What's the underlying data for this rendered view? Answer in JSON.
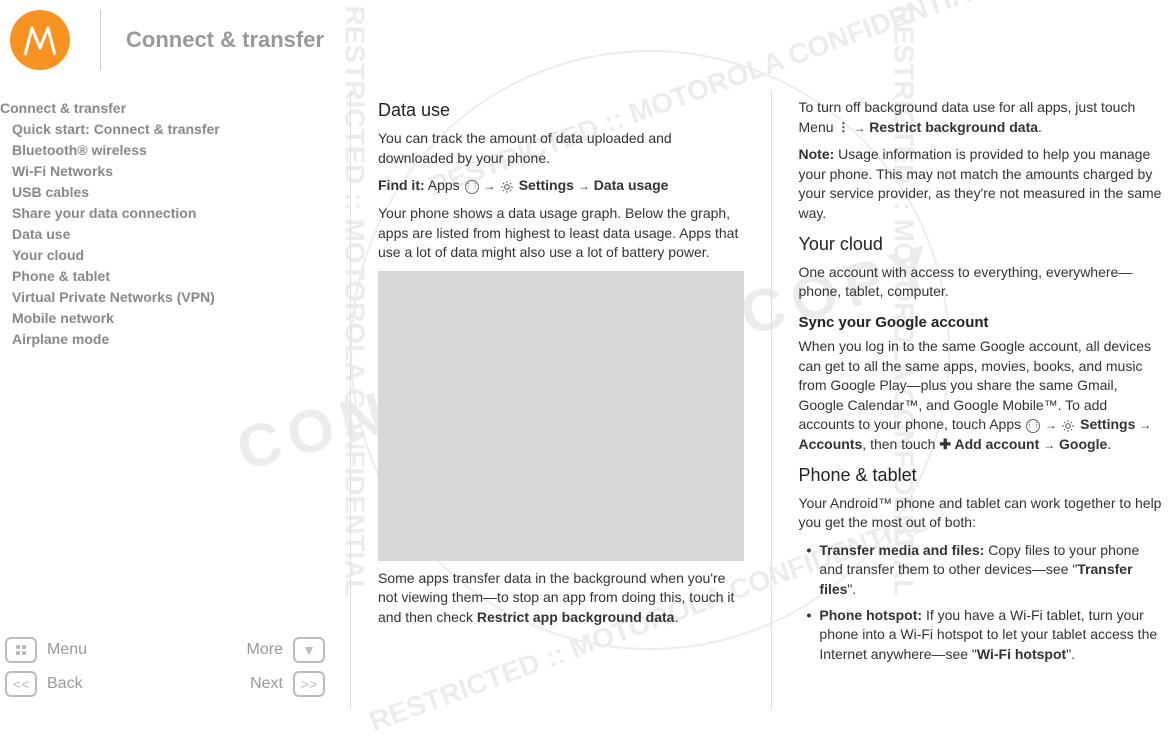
{
  "header": {
    "title": "Connect & transfer"
  },
  "sidebar": {
    "items": [
      {
        "label": "Connect & transfer",
        "level": 0
      },
      {
        "label": "Quick start: Connect & transfer",
        "level": 1
      },
      {
        "label": "Bluetooth® wireless",
        "level": 1
      },
      {
        "label": "Wi-Fi Networks",
        "level": 1
      },
      {
        "label": "USB cables",
        "level": 1
      },
      {
        "label": "Share your data connection",
        "level": 1
      },
      {
        "label": "Data use",
        "level": 1
      },
      {
        "label": "Your cloud",
        "level": 1
      },
      {
        "label": "Phone & tablet",
        "level": 1
      },
      {
        "label": "Virtual Private Networks (VPN)",
        "level": 1
      },
      {
        "label": "Mobile network",
        "level": 1
      },
      {
        "label": "Airplane mode",
        "level": 1
      }
    ]
  },
  "nav": {
    "menu": "Menu",
    "more": "More",
    "back": "Back",
    "next": "Next"
  },
  "col1": {
    "h_datause": "Data use",
    "p1": "You can track the amount of data uploaded and downloaded by your phone.",
    "findit_label": "Find it:",
    "findit_apps": " Apps ",
    "findit_settings": " Settings ",
    "findit_datausage": " Data usage",
    "p2": "Your phone shows a data usage graph. Below the graph, apps are listed from highest to least data usage. Apps that use a lot of data might also use a lot of battery power.",
    "p3a": "Some apps transfer data in the background when you're not viewing them—to stop an app from doing this, touch it and then check ",
    "p3b": "Restrict app background data",
    "p3c": "."
  },
  "col2": {
    "p1a": "To turn off background data use for all apps, just touch Menu ",
    "p1b": " Restrict background data",
    "p1c": ".",
    "note_label": "Note:",
    "note_text": " Usage information is provided to help you manage your phone. This may not match the amounts charged by your service provider, as they're not measured in the same way.",
    "h_cloud": "Your cloud",
    "p_cloud": "One account with access to everything, everywhere—phone, tablet, computer.",
    "h_sync": "Sync your Google account",
    "p_sync_a": "When you log in to the same Google account, all devices can get to all the same apps, movies, books, and music from Google Play—plus you share the same Gmail, Google Calendar™, and Google Mobile™. To add accounts to your phone, touch Apps ",
    "p_sync_settings": " Settings ",
    "p_sync_accounts": " Accounts",
    "p_sync_then": ", then touch ",
    "p_sync_add": " Add account ",
    "p_sync_google": " Google",
    "p_sync_end": ".",
    "h_pt": "Phone & tablet",
    "p_pt": "Your Android™ phone and tablet can work together to help you get the most out of both:",
    "b1_label": "Transfer media and files:",
    "b1_text_a": " Copy files to your phone and transfer them to other devices—see \"",
    "b1_link": "Transfer files",
    "b1_text_b": "\".",
    "b2_label": "Phone hotspot:",
    "b2_text_a": " If you have a Wi-Fi tablet, turn your phone into a Wi-Fi hotspot to let your tablet access the Internet anywhere—see \"",
    "b2_link": "Wi-Fi hotspot",
    "b2_text_b": "\"."
  },
  "watermarks": {
    "controlled": "CONTROLLED COPY",
    "restricted": "RESTRICTED :: MOTOROLA CONFIDENTIAL"
  }
}
